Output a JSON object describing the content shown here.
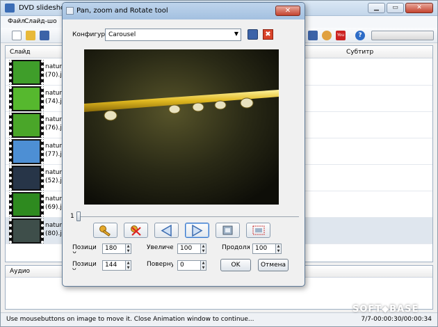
{
  "app": {
    "title": "DVD slideshow",
    "menu": [
      "Файл",
      "Слайд-шо"
    ],
    "columns": {
      "slide": "Слайд",
      "subtitle": "Субтитр"
    },
    "slides": [
      {
        "name_top": "natur",
        "name_bottom": "(70).jp",
        "color": "#3f9e2a"
      },
      {
        "name_top": "natur",
        "name_bottom": "(74).jp",
        "color": "#56b82e"
      },
      {
        "name_top": "natur",
        "name_bottom": "(76).jp",
        "color": "#4aa629"
      },
      {
        "name_top": "natur",
        "name_bottom": "(77).jp",
        "color": "#4d8fd4"
      },
      {
        "name_top": "natur",
        "name_bottom": "(52).jp",
        "color": "#273548"
      },
      {
        "name_top": "natur",
        "name_bottom": "(69).jp",
        "color": "#2e8a1f"
      },
      {
        "name_top": "natur",
        "name_bottom": "(80).jp",
        "color": "#3e4e4a"
      }
    ],
    "audio_label": "Аудио",
    "status_text": "Use mousebuttons on image to move it. Close Animation window to continue...",
    "status_time": "7/7-00:00:30/00:00:34",
    "watermark": "SOFT◆BASE"
  },
  "dialog": {
    "title": "Pan, zoom and Rotate tool",
    "config_label": "Конфигур",
    "config_value": "Carousel",
    "slider_value": "1",
    "fields": {
      "pos_x_label": "Позиция X",
      "pos_x": "180",
      "pos_y_label": "Позиция Y",
      "pos_y": "144",
      "zoom_label": "Увеличение",
      "zoom": "100",
      "rotate_label": "Повернуть",
      "rotate": "0",
      "duration_label": "Продолжи",
      "duration": "100"
    },
    "ok": "OK",
    "cancel": "Отмена"
  }
}
